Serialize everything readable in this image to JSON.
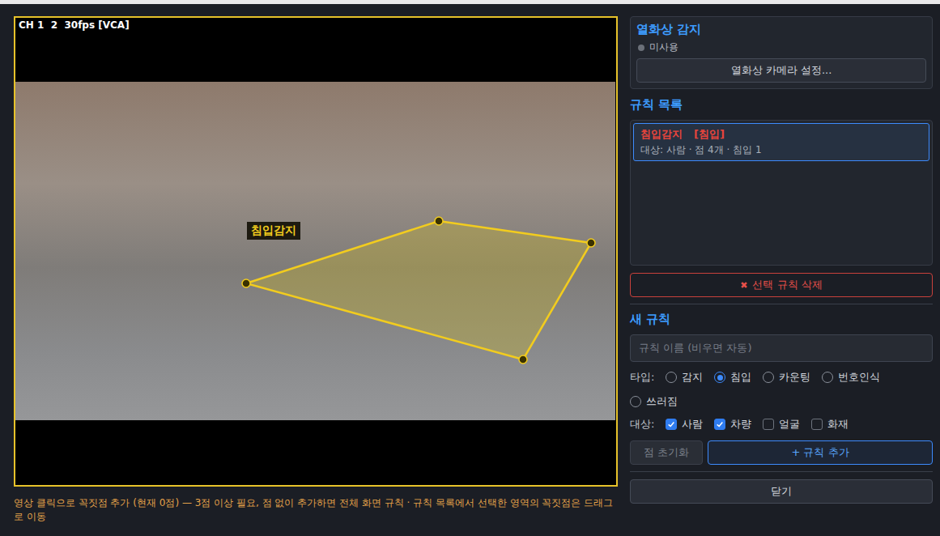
{
  "video": {
    "overlay": "CH 1  2  30fps [VCA]",
    "zone_label": "침입감지",
    "hint": "영상 클릭으로 꼭짓점 추가 (현재 0점) — 3점 이상 필요, 점 없이 추가하면 전체 화면 규칙 · 규칙 목록에서 선택한 영역의 꼭짓점은 드래그로 이동"
  },
  "thermal": {
    "title": "열화상 감지",
    "status": "미사용",
    "enabled": false,
    "button": "열화상 카메라 설정..."
  },
  "rules": {
    "title": "규칙 목록",
    "items": [
      {
        "name": "침입감지",
        "type": "[침입]",
        "detail": "대상: 사람 · 점 4개 · 침입 1",
        "selected": true
      }
    ],
    "delete_icon": "✖",
    "delete_label": "선택 규칙 삭제"
  },
  "new_rule": {
    "title": "새 규칙",
    "name_placeholder": "규칙 이름 (비우면 자동)",
    "type_label": "타입:",
    "types": [
      {
        "label": "감지",
        "selected": false
      },
      {
        "label": "침입",
        "selected": true
      },
      {
        "label": "카운팅",
        "selected": false
      },
      {
        "label": "번호인식",
        "selected": false
      },
      {
        "label": "쓰러짐",
        "selected": false
      }
    ],
    "target_label": "대상:",
    "targets": [
      {
        "label": "사람",
        "checked": true
      },
      {
        "label": "차량",
        "checked": true
      },
      {
        "label": "얼굴",
        "checked": false
      },
      {
        "label": "화재",
        "checked": false
      }
    ],
    "reset_button": {
      "label": "점 초기화",
      "disabled": true
    },
    "add_button": "+ 규칙 추가"
  },
  "close_button": "닫기"
}
